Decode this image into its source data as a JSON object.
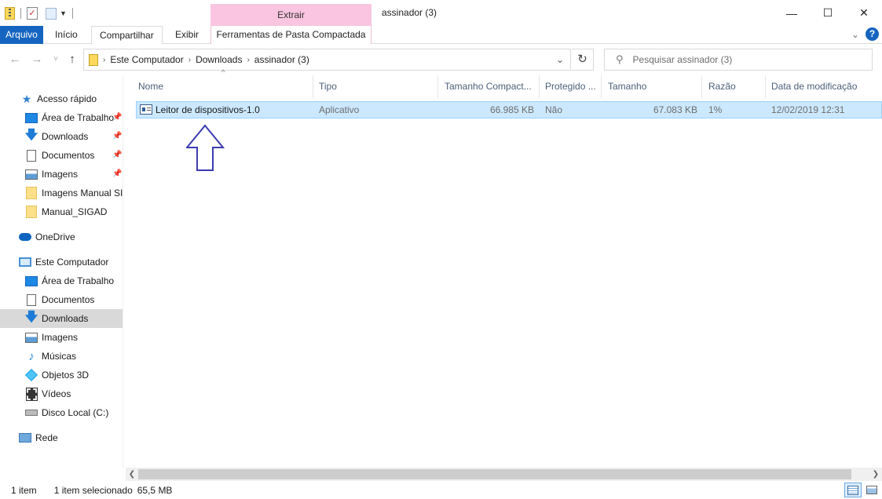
{
  "window": {
    "title": "assinador (3)",
    "contextual_tab_group": "Extrair",
    "controls": {
      "minimize": "—",
      "maximize": "☐",
      "close": "✕"
    }
  },
  "ribbon": {
    "tabs": [
      "Arquivo",
      "Início",
      "Compartilhar",
      "Exibir",
      "Ferramentas de Pasta Compactada"
    ]
  },
  "nav": {
    "back": "←",
    "forward": "→",
    "recent": "˅",
    "up": "↑",
    "breadcrumbs": [
      "Este Computador",
      "Downloads",
      "assinador (3)"
    ],
    "search_placeholder": "Pesquisar assinador (3)"
  },
  "sidebar": {
    "quick_access": "Acesso rápido",
    "quick_items": [
      {
        "label": "Área de Trabalho",
        "icon": "desktop-icon",
        "pinned": true
      },
      {
        "label": "Downloads",
        "icon": "download-icon",
        "pinned": true
      },
      {
        "label": "Documentos",
        "icon": "document-icon",
        "pinned": true
      },
      {
        "label": "Imagens",
        "icon": "pictures-icon",
        "pinned": true
      },
      {
        "label": "Imagens Manual SIGAD",
        "icon": "folder-icon",
        "pinned": false
      },
      {
        "label": "Manual_SIGAD",
        "icon": "folder-icon",
        "pinned": false
      }
    ],
    "onedrive": "OneDrive",
    "this_pc": "Este Computador",
    "pc_items": [
      {
        "label": "Área de Trabalho",
        "icon": "desktop-icon"
      },
      {
        "label": "Documentos",
        "icon": "document-icon"
      },
      {
        "label": "Downloads",
        "icon": "download-icon",
        "selected": true
      },
      {
        "label": "Imagens",
        "icon": "pictures-icon"
      },
      {
        "label": "Músicas",
        "icon": "music-icon"
      },
      {
        "label": "Objetos 3D",
        "icon": "3d-objects-icon"
      },
      {
        "label": "Vídeos",
        "icon": "video-icon"
      },
      {
        "label": "Disco Local (C:)",
        "icon": "disk-icon"
      }
    ],
    "network": "Rede"
  },
  "columns": [
    "Nome",
    "Tipo",
    "Tamanho Compact...",
    "Protegido ...",
    "Tamanho",
    "Razão",
    "Data de modificação"
  ],
  "files": [
    {
      "name": "Leitor de dispositivos-1.0",
      "type": "Aplicativo",
      "compressed_size": "66.985 KB",
      "protected": "Não",
      "size": "67.083 KB",
      "ratio": "1%",
      "modified": "12/02/2019 12:31"
    }
  ],
  "status": {
    "count": "1 item",
    "selected": "1 item selecionado",
    "selected_size": "65,5 MB"
  },
  "colors": {
    "file_tab": "#1565c0",
    "contextual": "#f9c5e0",
    "selection": "#cce8ff",
    "arrow_annotation": "#3b3bb0"
  }
}
